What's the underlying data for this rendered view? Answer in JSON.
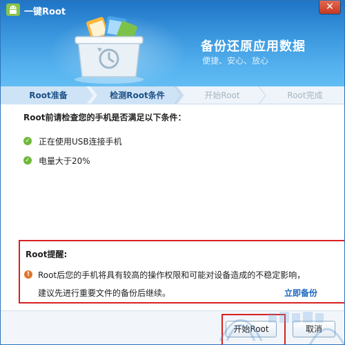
{
  "window": {
    "title": "一键Root",
    "close_glyph": "✕",
    "app_icon": "android-icon",
    "accent_color": "#2b73b8"
  },
  "banner": {
    "headline": "备份还原应用数据",
    "subline": "便捷、安心、放心",
    "illustration": "backup-folder-icon"
  },
  "steps": [
    {
      "label": "Root准备",
      "state": "done"
    },
    {
      "label": "检测Root条件",
      "state": "active"
    },
    {
      "label": "开始Root",
      "state": "todo"
    },
    {
      "label": "Root完成",
      "state": "todo"
    }
  ],
  "content": {
    "question": "Root前请检查您的手机是否满足以下条件：",
    "conditions": [
      {
        "text": "正在使用USB连接手机",
        "icon": "check-icon"
      },
      {
        "text": "电量大于20%",
        "icon": "check-icon"
      }
    ]
  },
  "warning": {
    "title": "Root提醒:",
    "line1": "Root后您的手机将具有较高的操作权限和可能对设备造成的不稳定影响，",
    "line2": "建议先进行重要文件的备份后继续。",
    "link": "立即备份",
    "icon": "exclamation-icon"
  },
  "footer": {
    "start_label": "开始Root",
    "cancel_label": "取消"
  }
}
